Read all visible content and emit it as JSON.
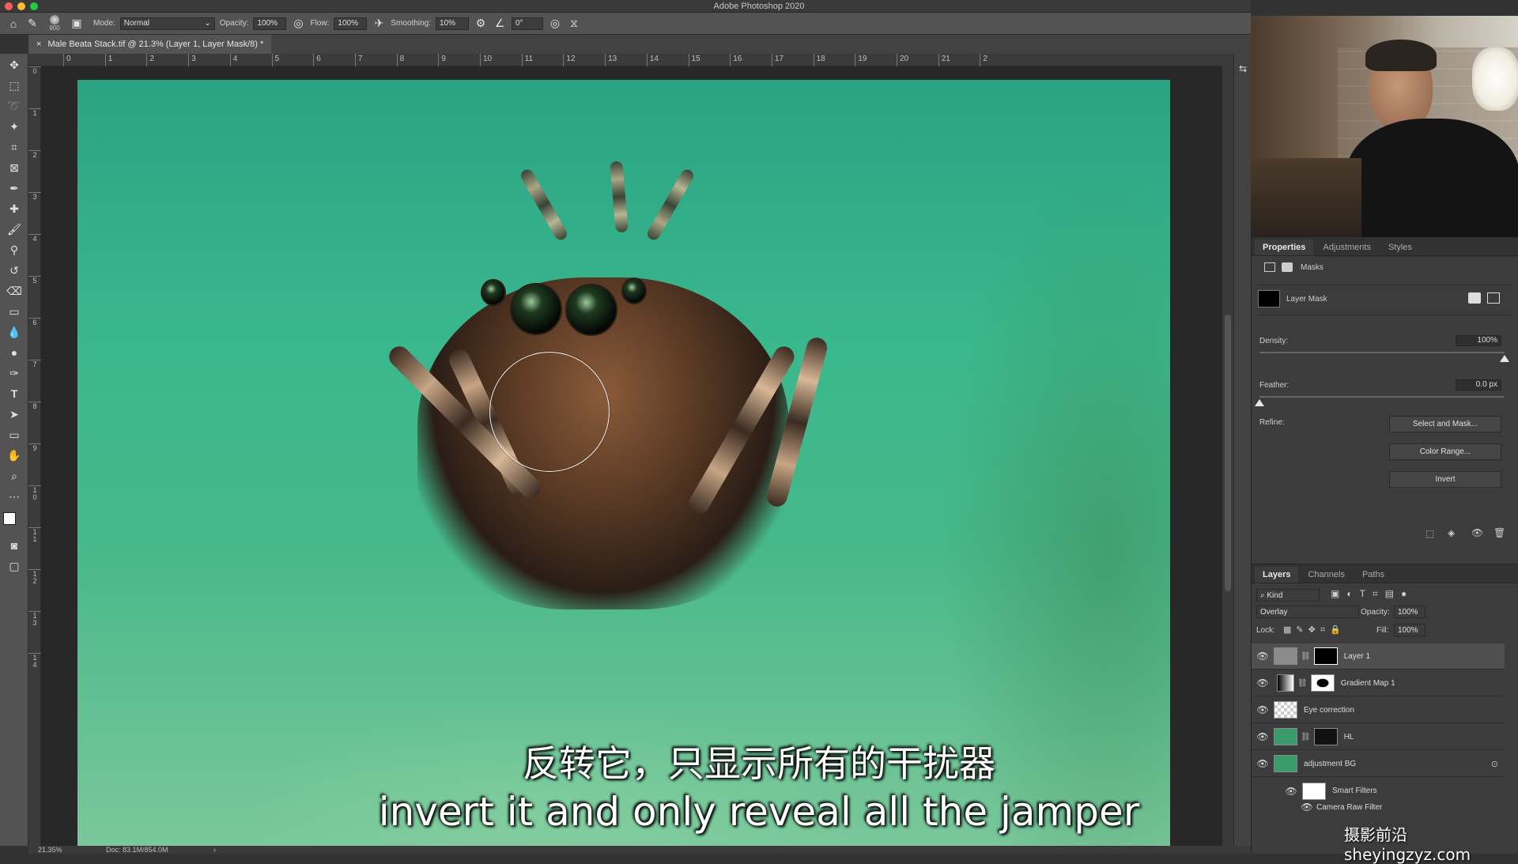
{
  "window": {
    "title": "Adobe Photoshop 2020"
  },
  "options_bar": {
    "brush_size": "900",
    "mode_label": "Mode:",
    "mode_value": "Normal",
    "opacity_label": "Opacity:",
    "opacity_value": "100%",
    "flow_label": "Flow:",
    "flow_value": "100%",
    "smoothing_label": "Smoothing:",
    "smoothing_value": "10%",
    "angle_value": "0°"
  },
  "document_tab": {
    "title": "Male Beata Stack.tif @ 21.3% (Layer 1, Layer Mask/8) *",
    "close": "×"
  },
  "ruler_h": [
    "0",
    "1",
    "2",
    "3",
    "4",
    "5",
    "6",
    "7",
    "8",
    "9",
    "10",
    "11",
    "12",
    "13",
    "14",
    "15",
    "16",
    "17",
    "18",
    "19",
    "20",
    "21",
    "2"
  ],
  "ruler_v": [
    "0",
    "1",
    "2",
    "3",
    "4",
    "5",
    "6",
    "7",
    "8",
    "9",
    "1\n0",
    "1\n1",
    "1\n2",
    "1\n3",
    "1\n4"
  ],
  "status": {
    "zoom": "21.35%",
    "doc": "Doc: 83.1M/854.0M",
    "arrow": "›"
  },
  "subtitles": {
    "zh": "反转它，只显示所有的干扰器",
    "en": "invert it and only reveal all the jamper"
  },
  "properties_panel": {
    "tabs": [
      "Properties",
      "Adjustments",
      "Styles"
    ],
    "masks_label": "Masks",
    "layer_mask_label": "Layer Mask",
    "density_label": "Density:",
    "density_value": "100%",
    "density_level": 1.0,
    "feather_label": "Feather:",
    "feather_value": "0.0 px",
    "feather_level": 0.0,
    "refine_label": "Refine:",
    "buttons": [
      "Select and Mask...",
      "Color Range...",
      "Invert"
    ]
  },
  "layers_panel": {
    "tabs": [
      "Layers",
      "Channels",
      "Paths"
    ],
    "filter_kind": "Kind",
    "blend_mode": "Overlay",
    "opacity_label": "Opacity:",
    "opacity_value": "100%",
    "lock_label": "Lock:",
    "fill_label": "Fill:",
    "fill_value": "100%",
    "layers": [
      {
        "name": "Layer 1",
        "selected": true
      },
      {
        "name": "Gradient Map 1",
        "selected": false
      },
      {
        "name": "Eye correction",
        "selected": false
      },
      {
        "name": "HL",
        "selected": false
      },
      {
        "name": "adjustment BG",
        "selected": false
      },
      {
        "name": "Smart Filters",
        "selected": false
      },
      {
        "name": "Camera Raw Filter",
        "selected": false
      }
    ]
  },
  "watermark": "摄影前沿 sheyingzyz.com",
  "colors": {
    "accent": "#3ab88d",
    "panel": "#3c3c3c",
    "toolbar": "#535353"
  }
}
